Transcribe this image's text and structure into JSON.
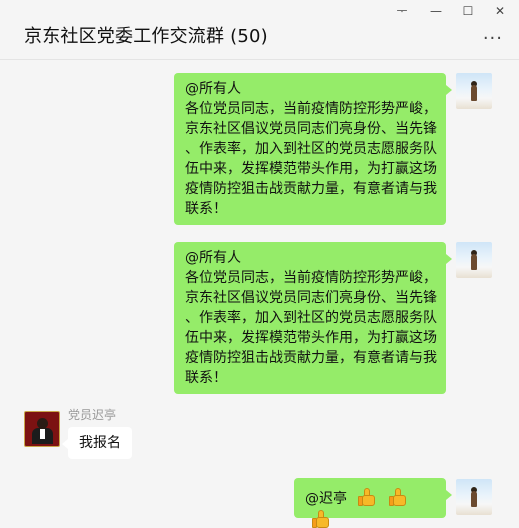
{
  "window": {
    "title": "京东社区党委工作交流群 (50)",
    "controls": {
      "pin": "ᅮ",
      "minimize": "—",
      "maximize": "☐",
      "close": "✕"
    },
    "more_label": "···"
  },
  "messages": [
    {
      "from": "me",
      "lines": [
        "@所有人",
        "各位党员同志，当前疫情防控形势严峻，",
        "京东社区倡议党员同志们亮身份、当先锋",
        "、作表率，加入到社区的党员志愿服务队",
        "伍中来，发挥模范带头作用，为打赢这场",
        "疫情防控狙击战贡献力量，有意者请与我",
        "联系！"
      ]
    },
    {
      "from": "me",
      "lines": [
        "@所有人",
        "各位党员同志，当前疫情防控形势严峻，",
        "京东社区倡议党员同志们亮身份、当先锋",
        "、作表率，加入到社区的党员志愿服务队",
        "伍中来，发挥模范带头作用，为打赢这场",
        "疫情防控狙击战贡献力量，有意者请与我",
        "联系！"
      ]
    },
    {
      "from": "other",
      "sender": "党员迟亭",
      "text": "我报名"
    },
    {
      "from": "me",
      "text": "@迟亭",
      "emoji": [
        "thumbs-up",
        "thumbs-up",
        "thumbs-up"
      ]
    }
  ]
}
